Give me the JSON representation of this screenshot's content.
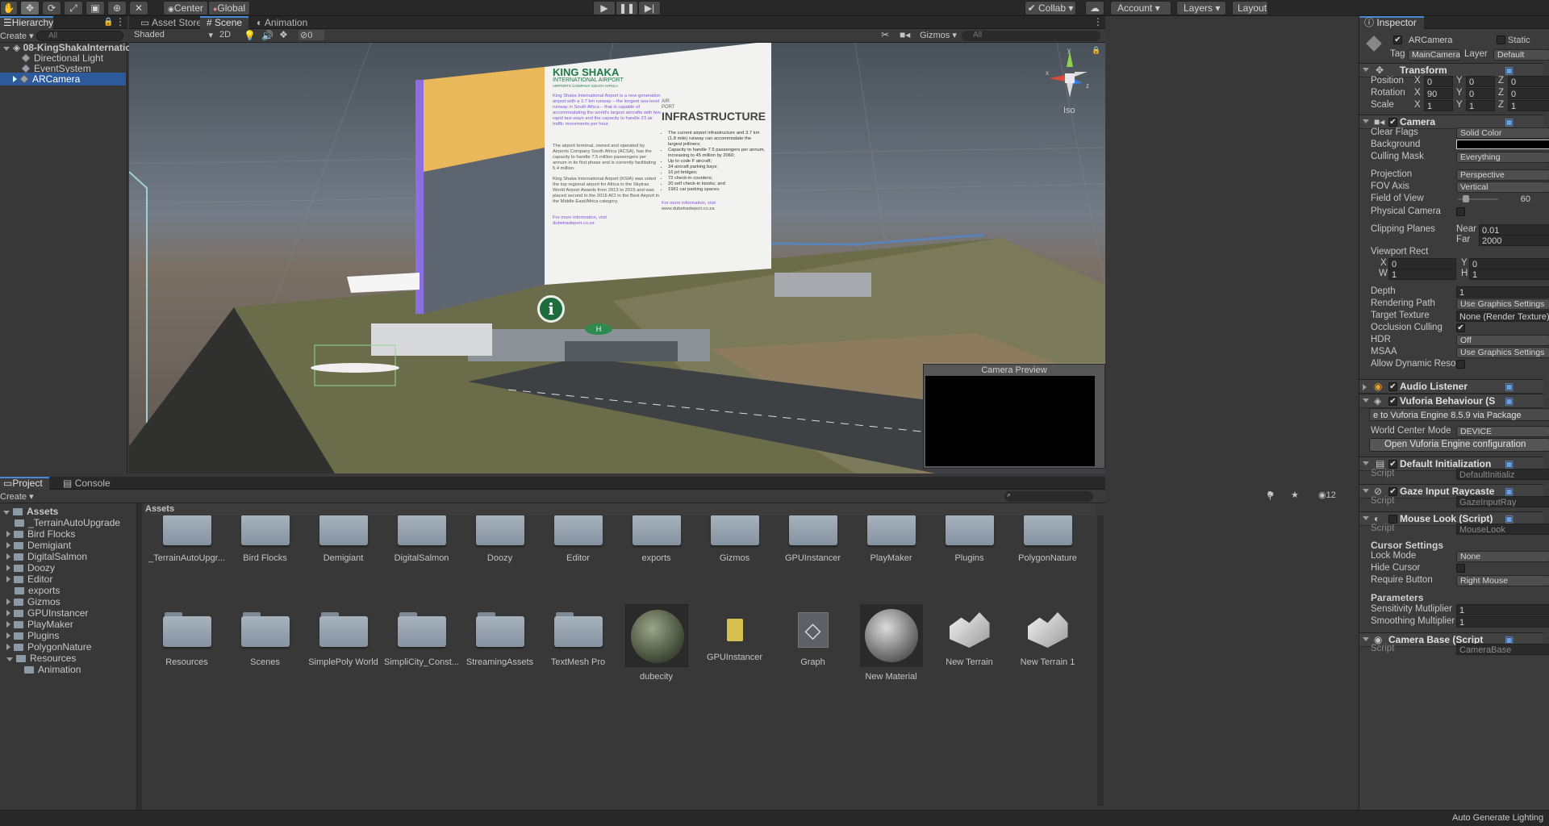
{
  "toolbar": {
    "pivot": "Center",
    "space": "Global",
    "collab": "Collab",
    "account": "Account",
    "layers": "Layers",
    "layout": "Layout"
  },
  "hierarchy": {
    "tab": "Hierarchy",
    "create": "Create",
    "search_placeholder": "All",
    "scene": "08-KingShakaInternatio",
    "items": [
      "Directional Light",
      "EventSystem",
      "ARCamera"
    ]
  },
  "scene_tabs": [
    "Asset Store",
    "Scene",
    "Animation"
  ],
  "scene_bar": {
    "shading": "Shaded",
    "mode2d": "2D",
    "hidden_count": "0",
    "gizmos": "Gizmos",
    "search_placeholder": "All",
    "iso": "Iso"
  },
  "scene_view": {
    "camera_preview": "Camera Preview",
    "board": {
      "logo_line1": "KING SHAKA",
      "logo_line2": "INTERNATIONAL AIRPORT",
      "logo_line3": "AIRPORTS COMPANY SOUTH AFRICA",
      "heading_small": "AIR PORT",
      "heading": "INFRASTRUCTURE",
      "intro": "King Shaka International Airport is a new generation airport with a 3.7 km runway – the longest sea-level runway in South Africa – that is capable of accommodating the world's largest aircrafts with two rapid taxi-ways and the capacity to handle 23 air traffic movements per hour.",
      "para2": "The airport terminal, owned and operated by Airports Company South Africa (ACSA), has the capacity to handle 7.5 million passengers per annum in its first phase and is currently facilitating 5.4 million.",
      "para3": "King Shaka International Airport (KSIA) was voted the top regional airport for Africa in the Skytrax World Airport Awards from 2013 to 2015 and was placed second in the 2016 ACI in the Best Airport in the Middle East/Africa category.",
      "more_info": "For more information, visit",
      "url": "dubetradeport.co.za",
      "bullets": [
        "The current airport infrastructure and 3.7 km (1.8 mile) runway can accommodate the largest jetliners;",
        "Capacity to handle 7.5 passengers per annum, increasing to 45 million by 2060;",
        "Up to code F aircraft;",
        "34 aircraft parking bays;",
        "16 jet bridges;",
        "72 check-in counters;",
        "20 self check-in kiosks; and",
        "1961 car parking spaces."
      ],
      "more_info2": "For more information, visit",
      "url2": "www.dubetradeport.co.za"
    },
    "info_marker": "i",
    "helipad": "H"
  },
  "project": {
    "tabs": [
      "Project",
      "Console"
    ],
    "create": "Create",
    "favourites_count": "12",
    "breadcrumb": "Assets",
    "tree_root": "Assets",
    "tree": [
      "_TerrainAutoUpgrade",
      "Bird Flocks",
      "Demigiant",
      "DigitalSalmon",
      "Doozy",
      "Editor",
      "exports",
      "Gizmos",
      "GPUInstancer",
      "PlayMaker",
      "Plugins",
      "PolygonNature",
      "Resources",
      "Animation"
    ],
    "grid_row1": [
      "_TerrainAutoUpgr...",
      "Bird Flocks",
      "Demigiant",
      "DigitalSalmon",
      "Doozy",
      "Editor",
      "exports",
      "Gizmos",
      "GPUInstancer",
      "PlayMaker",
      "Plugins",
      "PolygonNature"
    ],
    "grid_row2": [
      "Resources",
      "Scenes",
      "SimplePoly World",
      "SimpliCity_Const...",
      "StreamingAssets",
      "TextMesh Pro",
      "dubecity",
      "GPUInstancer",
      "Graph",
      "New Material",
      "New Terrain",
      "New Terrain 1"
    ]
  },
  "status": {
    "right": "Auto Generate Lighting"
  },
  "inspector": {
    "tab": "Inspector",
    "object_name": "ARCamera",
    "static": "Static",
    "tag_label": "Tag",
    "tag": "MainCamera",
    "layer_label": "Layer",
    "layer": "Default",
    "transform": {
      "title": "Transform",
      "position": {
        "label": "Position",
        "x": "0",
        "y": "0",
        "z": "0"
      },
      "rotation": {
        "label": "Rotation",
        "x": "90",
        "y": "0",
        "z": "0"
      },
      "scale": {
        "label": "Scale",
        "x": "1",
        "y": "1",
        "z": "1"
      }
    },
    "camera": {
      "title": "Camera",
      "clear_flags": {
        "label": "Clear Flags",
        "value": "Solid Color"
      },
      "background": {
        "label": "Background"
      },
      "culling_mask": {
        "label": "Culling Mask",
        "value": "Everything"
      },
      "projection": {
        "label": "Projection",
        "value": "Perspective"
      },
      "fov_axis": {
        "label": "FOV Axis",
        "value": "Vertical"
      },
      "field_of_view": {
        "label": "Field of View",
        "value": "60",
        "fraction": 0.12
      },
      "physical_camera": {
        "label": "Physical Camera"
      },
      "clipping_planes": {
        "label": "Clipping Planes",
        "near_label": "Near",
        "near": "0.01",
        "far_label": "Far",
        "far": "2000"
      },
      "viewport_rect": {
        "label": "Viewport Rect",
        "x": "0",
        "y": "0",
        "w": "1",
        "h": "1"
      },
      "depth": {
        "label": "Depth",
        "value": "1"
      },
      "rendering_path": {
        "label": "Rendering Path",
        "value": "Use Graphics Settings"
      },
      "target_texture": {
        "label": "Target Texture",
        "value": "None (Render Texture)"
      },
      "occlusion_culling": {
        "label": "Occlusion Culling"
      },
      "hdr": {
        "label": "HDR",
        "value": "Off"
      },
      "msaa": {
        "label": "MSAA",
        "value": "Use Graphics Settings"
      },
      "allow_dynamic": {
        "label": "Allow Dynamic Resol"
      }
    },
    "audio_listener": "Audio Listener",
    "vuforia": {
      "title": "Vuforia Behaviour (S",
      "notice": "e to Vuforia Engine 8.5.9 via Package",
      "world_center_label": "World Center Mode",
      "world_center": "DEVICE",
      "open_button": "Open Vuforia Engine configuration"
    },
    "default_init": {
      "title": "Default Initialization",
      "script_label": "Script",
      "script": "DefaultInitializ"
    },
    "gaze": {
      "title": "Gaze Input Raycaste",
      "script_label": "Script",
      "script": "GazeInputRay"
    },
    "mouse_look": {
      "title": "Mouse Look (Script)",
      "script_label": "Script",
      "script": "MouseLook",
      "cursor_settings": "Cursor Settings",
      "lock_mode_label": "Lock Mode",
      "lock_mode": "None",
      "hide_cursor_label": "Hide Cursor",
      "require_button_label": "Require Button",
      "require_button": "Right Mouse",
      "parameters": "Parameters",
      "sens_label": "Sensitivity Mutliplier",
      "sens": "1",
      "smooth_label": "Smoothing Multiplier",
      "smooth": "1"
    },
    "camera_base": {
      "title": "Camera Base (Script",
      "script_label": "Script",
      "script": "CameraBase"
    }
  },
  "colors": {
    "selection": "#2c5a9a",
    "accent": "#4a88d8",
    "dark_bg": "#383838"
  }
}
